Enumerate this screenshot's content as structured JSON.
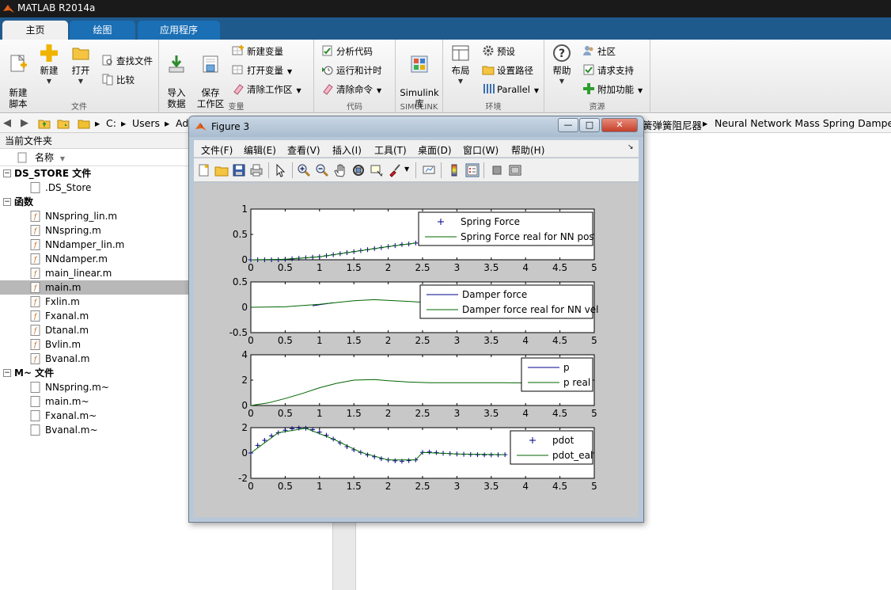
{
  "app": {
    "title": "MATLAB R2014a"
  },
  "ribbon_tabs": [
    {
      "label": "主页"
    },
    {
      "label": "绘图"
    },
    {
      "label": "应用程序"
    }
  ],
  "ribbon": {
    "file_group": {
      "label": "文件",
      "new_script": "新建\n脚本",
      "new": "新建",
      "open": "打开",
      "find_files": "查找文件",
      "compare": "比较"
    },
    "variable_group": {
      "label": "变量",
      "import_data": "导入\n数据",
      "save_workspace": "保存\n工作区",
      "new_variable": "新建变量",
      "open_variable": "打开变量",
      "clear_workspace": "清除工作区"
    },
    "code_group": {
      "label": "代码",
      "analyze_code": "分析代码",
      "run_and_time": "运行和计时",
      "clear_commands": "清除命令"
    },
    "simulink_group": {
      "label": "SIMULINK",
      "library": "Simulink\n库"
    },
    "environment_group": {
      "label": "环境",
      "layout": "布局",
      "preferences": "预设",
      "set_path": "设置路径",
      "parallel": "Parallel"
    },
    "resources_group": {
      "label": "资源",
      "help": "帮助",
      "community": "社区",
      "request_support": "请求支持",
      "addons": "附加功能"
    }
  },
  "address": {
    "crumbs": [
      "C:",
      "Users",
      "Ad"
    ],
    "trailing": [
      "簧弹簧阻尼器",
      "Neural Network Mass Spring Damper"
    ]
  },
  "folder_panel": {
    "title": "当前文件夹",
    "column_name": "名称",
    "groups": [
      {
        "name": "DS_STORE 文件",
        "files": [
          ".DS_Store"
        ]
      },
      {
        "name": "函数",
        "files": [
          "NNspring_lin.m",
          "NNspring.m",
          "NNdamper_lin.m",
          "NNdamper.m",
          "main_linear.m",
          "main.m",
          "Fxlin.m",
          "Fxanal.m",
          "Dtanal.m",
          "Bvlin.m",
          "Bvanal.m"
        ]
      },
      {
        "name": "M~ 文件",
        "files": [
          "NNspring.m~",
          "main.m~",
          "Fxanal.m~",
          "Bvanal.m~"
        ]
      }
    ],
    "selected_file": "main.m"
  },
  "figure": {
    "title": "Figure 3",
    "menu": [
      "文件(F)",
      "编辑(E)",
      "查看(V)",
      "插入(I)",
      "工具(T)",
      "桌面(D)",
      "窗口(W)",
      "帮助(H)"
    ],
    "window_buttons": {
      "minimize": "—",
      "maximize": "□",
      "close": "✕"
    }
  },
  "colors": {
    "blue_series": "#00008b",
    "green_series": "#006400",
    "ribbon_blue": "#1f5a8c"
  },
  "chart_data": [
    {
      "type": "line",
      "xlim": [
        0,
        5
      ],
      "ylim": [
        0,
        1
      ],
      "xticks": [
        "0",
        "0.5",
        "1",
        "1.5",
        "2",
        "2.5",
        "3",
        "3.5",
        "4",
        "4.5",
        "5"
      ],
      "yticks": [
        "0",
        "0.5",
        "1"
      ],
      "legend_position": "top-right",
      "series": [
        {
          "name": "Spring Force",
          "marker": "+",
          "x": [
            0,
            0.1,
            0.2,
            0.3,
            0.4,
            0.5,
            0.6,
            0.7,
            0.8,
            0.9,
            1.0,
            1.1,
            1.2,
            1.3,
            1.4,
            1.5,
            1.6,
            1.7,
            1.8,
            1.9,
            2.0,
            2.1,
            2.2,
            2.3,
            2.4
          ],
          "y": [
            0,
            0,
            0,
            0,
            0,
            0.01,
            0.02,
            0.03,
            0.04,
            0.05,
            0.06,
            0.08,
            0.1,
            0.12,
            0.14,
            0.16,
            0.18,
            0.2,
            0.22,
            0.24,
            0.26,
            0.28,
            0.3,
            0.31,
            0.33
          ]
        },
        {
          "name": "Spring Force real for NN pos",
          "x": [
            0,
            0.5,
            1.0,
            1.5,
            2.0,
            2.4
          ],
          "y": [
            0,
            0.01,
            0.06,
            0.16,
            0.26,
            0.33
          ]
        }
      ]
    },
    {
      "type": "line",
      "xlim": [
        0,
        5
      ],
      "ylim": [
        -0.5,
        0.5
      ],
      "xticks": [
        "0",
        "0.5",
        "1",
        "1.5",
        "2",
        "2.5",
        "3",
        "3.5",
        "4",
        "4.5",
        "5"
      ],
      "yticks": [
        "-0.5",
        "0",
        "0.5"
      ],
      "legend_position": "top-right",
      "series": [
        {
          "name": "Damper force",
          "x": [
            0.9,
            1.0,
            1.1,
            1.2
          ],
          "y": [
            0.03,
            0.05,
            0.07,
            0.09
          ]
        },
        {
          "name": "Damper force real for NN vel",
          "x": [
            0,
            0.5,
            1.0,
            1.5,
            1.8,
            2.1,
            2.5
          ],
          "y": [
            0,
            0.01,
            0.06,
            0.13,
            0.15,
            0.13,
            0.1
          ]
        }
      ]
    },
    {
      "type": "line",
      "xlim": [
        0,
        5
      ],
      "ylim": [
        0,
        4
      ],
      "xticks": [
        "0",
        "0.5",
        "1",
        "1.5",
        "2",
        "2.5",
        "3",
        "3.5",
        "4",
        "4.5",
        "5"
      ],
      "yticks": [
        "0",
        "2",
        "4"
      ],
      "legend_position": "top-right",
      "series": [
        {
          "name": "p",
          "x": [],
          "y": []
        },
        {
          "name": "p real",
          "x": [
            0,
            0.25,
            0.5,
            0.75,
            1.0,
            1.25,
            1.5,
            1.8,
            2.0,
            2.3,
            2.6,
            3.0,
            3.5,
            4.0
          ],
          "y": [
            0,
            0.2,
            0.55,
            0.95,
            1.4,
            1.75,
            2.0,
            2.05,
            1.95,
            1.85,
            1.8,
            1.8,
            1.8,
            1.78
          ]
        }
      ]
    },
    {
      "type": "line",
      "xlim": [
        0,
        5
      ],
      "ylim": [
        -2,
        2
      ],
      "xticks": [
        "0",
        "0.5",
        "1",
        "1.5",
        "2",
        "2.5",
        "3",
        "3.5",
        "4",
        "4.5",
        "5"
      ],
      "yticks": [
        "-2",
        "0",
        "2"
      ],
      "legend_position": "top-right",
      "series": [
        {
          "name": "pdot",
          "marker": "+",
          "x": [
            0,
            0.1,
            0.2,
            0.3,
            0.4,
            0.5,
            0.6,
            0.7,
            0.8,
            0.9,
            1.0,
            1.1,
            1.2,
            1.3,
            1.4,
            1.5,
            1.6,
            1.7,
            1.8,
            1.9,
            2.0,
            2.1,
            2.2,
            2.3,
            2.4,
            2.5,
            2.6,
            2.7,
            2.8,
            2.9,
            3.0,
            3.1,
            3.2,
            3.3,
            3.4,
            3.5,
            3.6,
            3.7
          ],
          "y": [
            0,
            0.6,
            1.0,
            1.35,
            1.6,
            1.8,
            1.92,
            1.97,
            1.95,
            1.85,
            1.65,
            1.4,
            1.1,
            0.8,
            0.5,
            0.25,
            0.05,
            -0.15,
            -0.3,
            -0.45,
            -0.55,
            -0.62,
            -0.65,
            -0.6,
            -0.55,
            0.05,
            0.08,
            0.03,
            -0.02,
            -0.05,
            -0.08,
            -0.1,
            -0.12,
            -0.13,
            -0.15,
            -0.15,
            -0.14,
            -0.13
          ]
        },
        {
          "name": "pdot_eal",
          "x": [
            0,
            0.4,
            0.8,
            1.2,
            1.6,
            2.0,
            2.4,
            2.5,
            3.0,
            3.7
          ],
          "y": [
            0,
            1.6,
            1.95,
            1.1,
            0.05,
            -0.55,
            -0.55,
            0.05,
            -0.08,
            -0.13
          ]
        }
      ]
    }
  ]
}
